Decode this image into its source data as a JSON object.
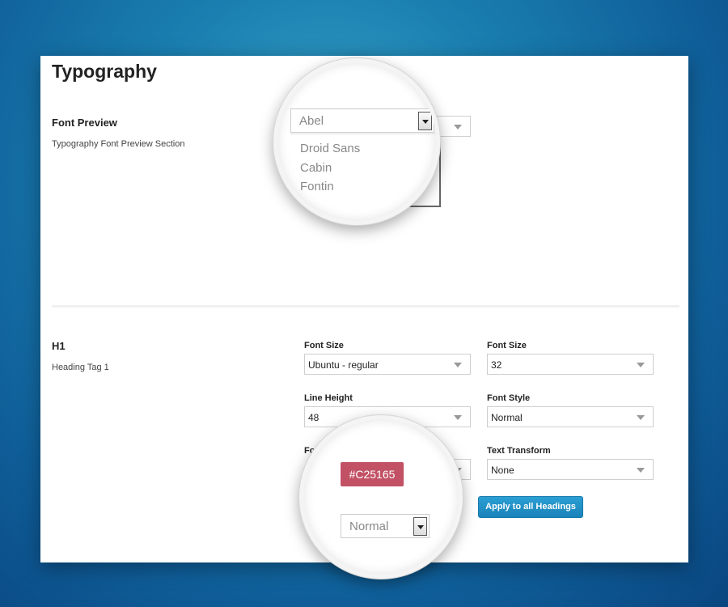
{
  "page": {
    "title": "Typography"
  },
  "font_preview": {
    "title": "Font Preview",
    "description": "Typography Font Preview Section",
    "dropdown": {
      "selected": "Abel",
      "options": [
        "Droid Sans",
        "Cabin",
        "Fontin"
      ]
    }
  },
  "h1": {
    "title": "H1",
    "description": "Heading Tag 1",
    "fields": {
      "font_family": {
        "label": "Font Size",
        "value": "Ubuntu - regular"
      },
      "font_size": {
        "label": "Font Size",
        "value": "32"
      },
      "line_height": {
        "label": "Line Height",
        "value": "48"
      },
      "font_style": {
        "label": "Font Style",
        "value": "Normal"
      },
      "font_color": {
        "label_partial": "Fo",
        "value": "#C25165"
      },
      "text_transform": {
        "label": "Text Transform",
        "value": "None"
      },
      "font_weight": {
        "value": "Normal"
      }
    },
    "apply_button": "Apply to all Headings"
  },
  "colors": {
    "accent": "#C25165",
    "button": "#1a83b8"
  }
}
